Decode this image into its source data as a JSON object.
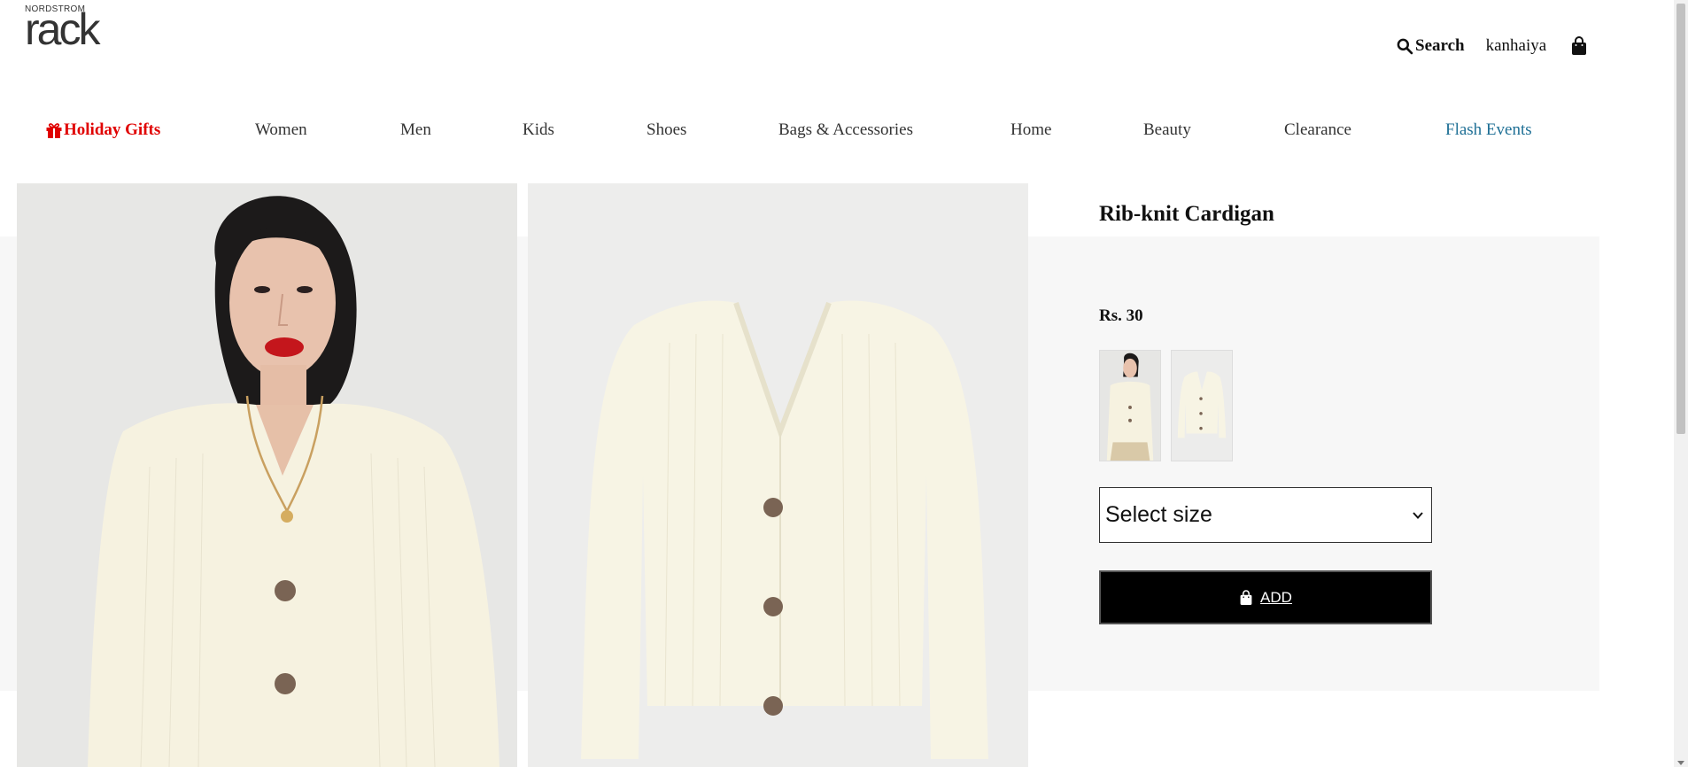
{
  "header": {
    "logo_top": "NORDSTROM",
    "logo_main": "rack",
    "search_label": "Search",
    "username": "kanhaiya",
    "search_icon": "search-icon",
    "bag_icon": "shopping-bag-icon"
  },
  "nav": {
    "items": [
      {
        "label": "Holiday Gifts",
        "icon": "gift-icon",
        "color": "#e00000"
      },
      {
        "label": "Women"
      },
      {
        "label": "Men"
      },
      {
        "label": "Kids"
      },
      {
        "label": "Shoes"
      },
      {
        "label": "Bags & Accessories"
      },
      {
        "label": "Home"
      },
      {
        "label": "Beauty"
      },
      {
        "label": "Clearance"
      },
      {
        "label": "Flash Events",
        "color": "#1e6f95"
      }
    ]
  },
  "product": {
    "title": "Rib-knit Cardigan",
    "price": "Rs. 30",
    "size_select": {
      "selected": "Select size"
    },
    "add_button": {
      "label": "ADD",
      "icon": "shopping-bag-icon"
    }
  },
  "colors": {
    "accent_red": "#e00000",
    "accent_blue": "#1e6f95",
    "button_bg": "#000000",
    "panel_bg": "#f7f7f7"
  }
}
